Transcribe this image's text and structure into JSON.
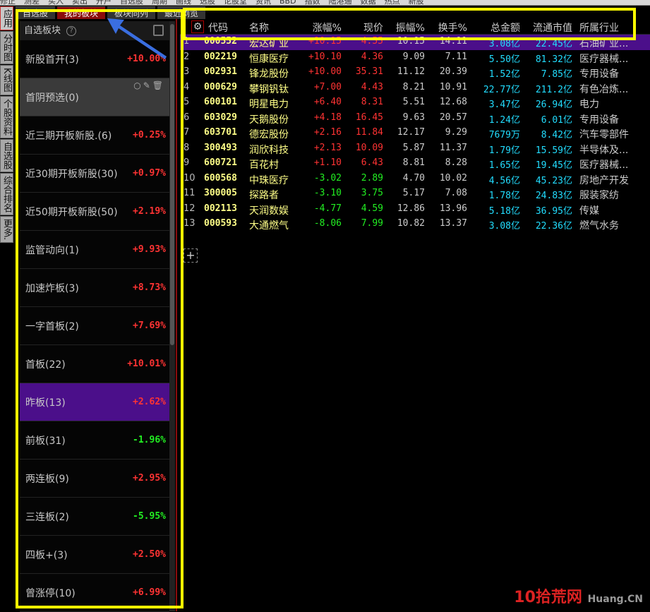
{
  "topbar": {
    "items": [
      "修正",
      "测差",
      "买入",
      "卖出",
      "开户",
      "自选股",
      "周期",
      "画线",
      "选股",
      "论股堂",
      "资讯",
      "BBD",
      "指数",
      "陆港通",
      "数据",
      "热点",
      "新股"
    ]
  },
  "vtabs": [
    "应用",
    "分时图",
    "K线图",
    "个股资料",
    "自选股",
    "综合排名",
    "更多."
  ],
  "tabs": [
    "自选股",
    "我的板块",
    "板块同列",
    "最近浏览"
  ],
  "panel": {
    "title": "自选板块",
    "help": "?",
    "items": [
      {
        "name": "新股首开(3)",
        "pct": "+10.00%",
        "dir": "up"
      },
      {
        "name": "首阴预选(0)",
        "pct": "",
        "dir": "up",
        "state": "hover"
      },
      {
        "name": "近三期开板新股.(6)",
        "pct": "+0.25%",
        "dir": "up"
      },
      {
        "name": "近30期开板新股(30)",
        "pct": "+0.97%",
        "dir": "up"
      },
      {
        "name": "近50期开板新股(50)",
        "pct": "+2.19%",
        "dir": "up"
      },
      {
        "name": "监管动向(1)",
        "pct": "+9.93%",
        "dir": "up"
      },
      {
        "name": "加速炸板(3)",
        "pct": "+8.73%",
        "dir": "up"
      },
      {
        "name": "一字首板(2)",
        "pct": "+7.69%",
        "dir": "up"
      },
      {
        "name": "首板(22)",
        "pct": "+10.01%",
        "dir": "up"
      },
      {
        "name": "昨板(13)",
        "pct": "+2.62%",
        "dir": "up",
        "state": "sel"
      },
      {
        "name": "前板(31)",
        "pct": "-1.96%",
        "dir": "dn"
      },
      {
        "name": "两连板(9)",
        "pct": "+2.95%",
        "dir": "up"
      },
      {
        "name": "三连板(2)",
        "pct": "-5.95%",
        "dir": "dn"
      },
      {
        "name": "四板+(3)",
        "pct": "+2.50%",
        "dir": "up"
      },
      {
        "name": "曾涨停(10)",
        "pct": "+6.99%",
        "dir": "up"
      }
    ]
  },
  "table": {
    "headers": [
      "代码",
      "名称",
      "涨幅%",
      "现价",
      "振幅%",
      "换手%",
      "总金额",
      "流通市值",
      "所属行业"
    ],
    "rows": [
      [
        "1",
        "000552",
        "宏达矿业",
        "+10.15",
        "4.55",
        "10.15",
        "14.11",
        "3.08亿",
        "22.45亿",
        "石油矿业...",
        "up"
      ],
      [
        "2",
        "002219",
        "恒康医疗",
        "+10.10",
        "4.36",
        "9.09",
        "7.11",
        "5.50亿",
        "81.32亿",
        "医疗器械...",
        "up"
      ],
      [
        "3",
        "002931",
        "锋龙股份",
        "+10.00",
        "35.31",
        "11.12",
        "20.39",
        "1.52亿",
        "7.85亿",
        "专用设备",
        "up"
      ],
      [
        "4",
        "000629",
        "攀钢钒钛",
        "+7.00",
        "4.43",
        "8.21",
        "10.91",
        "22.77亿",
        "211.2亿",
        "有色冶炼...",
        "up"
      ],
      [
        "5",
        "600101",
        "明星电力",
        "+6.40",
        "8.31",
        "5.51",
        "12.68",
        "3.47亿",
        "26.94亿",
        "电力",
        "up"
      ],
      [
        "6",
        "603029",
        "天鹅股份",
        "+4.18",
        "16.45",
        "9.63",
        "20.57",
        "1.24亿",
        "6.01亿",
        "专用设备",
        "up"
      ],
      [
        "7",
        "603701",
        "德宏股份",
        "+2.16",
        "11.84",
        "12.17",
        "9.29",
        "7679万",
        "8.42亿",
        "汽车零部件",
        "up"
      ],
      [
        "8",
        "300493",
        "润欣科技",
        "+2.13",
        "10.09",
        "5.87",
        "11.37",
        "1.79亿",
        "15.59亿",
        "半导体及...",
        "up"
      ],
      [
        "9",
        "600721",
        "百花村",
        "+1.10",
        "6.43",
        "8.81",
        "8.28",
        "1.65亿",
        "19.45亿",
        "医疗器械...",
        "up"
      ],
      [
        "10",
        "600568",
        "中珠医疗",
        "-3.02",
        "2.89",
        "4.70",
        "10.02",
        "4.56亿",
        "45.23亿",
        "房地产开发",
        "dn"
      ],
      [
        "11",
        "300005",
        "探路者",
        "-3.10",
        "3.75",
        "5.17",
        "7.08",
        "1.78亿",
        "24.83亿",
        "服装家纺",
        "dn"
      ],
      [
        "12",
        "002113",
        "天润数娱",
        "-4.77",
        "4.59",
        "12.86",
        "13.96",
        "5.18亿",
        "36.95亿",
        "传媒",
        "dn"
      ],
      [
        "13",
        "000593",
        "大通燃气",
        "-8.06",
        "7.99",
        "10.82",
        "13.37",
        "3.08亿",
        "22.36亿",
        "燃气水务",
        "dn"
      ]
    ]
  },
  "watermark": {
    "text": "10拾荒网",
    "sub": "Huang.CN"
  },
  "colors": {
    "up": "#ff3333",
    "down": "#22ee22",
    "selected": "#4b0f8a",
    "annotation": "#ffff00",
    "arrow": "#3a6ee0"
  }
}
